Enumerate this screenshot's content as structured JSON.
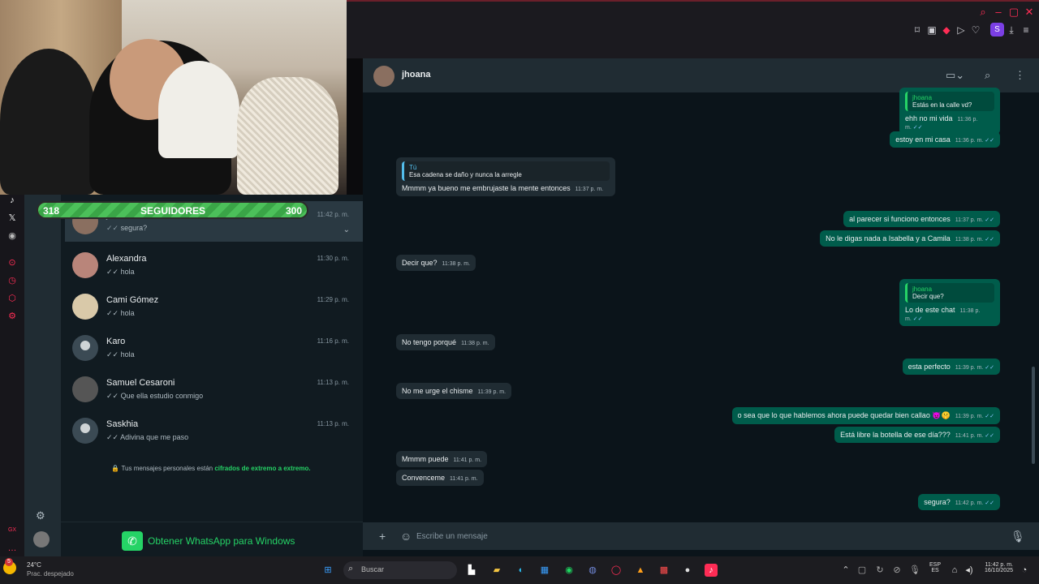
{
  "stream": {
    "followers_left": "318",
    "followers_label": "SEGUIDORES",
    "followers_right": "300",
    "followers_progress": 1.0
  },
  "chat_list": [
    {
      "name": "jhoana",
      "preview": "segura?",
      "time": "11:42 p. m.",
      "active": true
    },
    {
      "name": "Alexandra",
      "preview": "hola",
      "time": "11:30 p. m."
    },
    {
      "name": "Cami Gómez",
      "preview": "hola",
      "time": "11:29 p. m."
    },
    {
      "name": "Karo",
      "preview": "hola",
      "time": "11:16 p. m."
    },
    {
      "name": "Samuel Cesaroni",
      "preview": "Que ella estudio conmigo",
      "time": "11:13 p. m."
    },
    {
      "name": "Saskhia",
      "preview": "Adivina que me paso",
      "time": "11:13 p. m."
    }
  ],
  "encryption_notice": {
    "prefix": "Tus mensajes personales están ",
    "link": "cifrados de extremo a extremo."
  },
  "get_whatsapp": "Obtener WhatsApp para Windows",
  "conversation": {
    "contact": "jhoana",
    "messages": [
      {
        "dir": "out",
        "quote_name": "jhoana",
        "quote": "Estás en la calle vd?",
        "text": "ehh no mi vida",
        "time": "11:36 p. m."
      },
      {
        "dir": "out",
        "text": "estoy en mi casa",
        "time": "11:36 p. m."
      },
      {
        "dir": "in",
        "quote_name": "Tú",
        "quote": "Esa cadena se daño y nunca la arregle",
        "text": "Mmmm ya bueno me embrujaste la mente entonces",
        "time": "11:37 p. m."
      },
      {
        "dir": "out",
        "text": "al parecer si funciono entonces",
        "time": "11:37 p. m."
      },
      {
        "dir": "out",
        "text": "No le digas nada a Isabella y a Camila",
        "time": "11:38 p. m."
      },
      {
        "dir": "in",
        "text": "Decir que?",
        "time": "11:38 p. m."
      },
      {
        "dir": "out",
        "quote_name": "jhoana",
        "quote": "Decir que?",
        "text": "Lo de este chat",
        "time": "11:38 p. m."
      },
      {
        "dir": "in",
        "text": "No tengo porqué",
        "time": "11:38 p. m."
      },
      {
        "dir": "out",
        "text": "esta perfecto",
        "time": "11:39 p. m."
      },
      {
        "dir": "in",
        "text": "No me urge el chisme",
        "time": "11:39 p. m."
      },
      {
        "dir": "out",
        "text": "o sea que lo que hablemos ahora puede quedar bien callao 😈🤫",
        "time": "11:39 p. m."
      },
      {
        "dir": "out",
        "text": "Está libre la botella de ese día???",
        "time": "11:41 p. m."
      },
      {
        "dir": "in",
        "text": "Mmmm puede",
        "time": "11:41 p. m."
      },
      {
        "dir": "in",
        "text": "Convenceme",
        "time": "11:41 p. m."
      },
      {
        "dir": "out",
        "text": "segura?",
        "time": "11:42 p. m."
      }
    ],
    "composer_placeholder": "Escribe un mensaje"
  },
  "taskbar": {
    "weather_temp": "24°C",
    "weather_desc": "Prac. despejado",
    "search_placeholder": "Buscar",
    "lang_top": "ESP",
    "lang_bottom": "ES",
    "time": "11:42 p. m.",
    "date": "16/10/2025",
    "notification_badge": "5"
  },
  "colors": {
    "accent": "#25d366",
    "outgoing": "#005c4b",
    "incoming": "#202c33",
    "opera_red": "#ff2d55"
  }
}
